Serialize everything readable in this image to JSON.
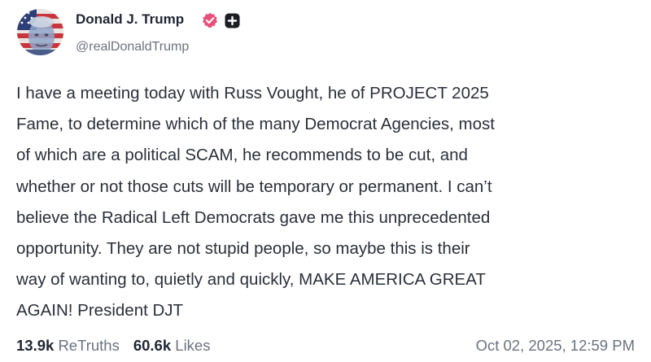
{
  "author": {
    "name": "Donald J. Trump",
    "handle": "@realDonaldTrump",
    "verified_color": "#e8507a",
    "badges": [
      "verified-icon",
      "plus-badge-icon"
    ]
  },
  "post": {
    "lines": [
      "I have a meeting today with Russ Vought, he of PROJECT 2025",
      "Fame,  to determine which of the many Democrat Agencies, most",
      "of which are a political SCAM, he recommends to be cut, and",
      "whether or not those cuts will be temporary or permanent. I can’t",
      "believe the Radical Left Democrats gave me this unprecedented",
      "opportunity. They are not stupid people, so maybe this is their",
      "way of wanting to, quietly and quickly, MAKE AMERICA GREAT",
      "AGAIN! President DJT"
    ]
  },
  "stats": {
    "retruths_count": "13.9k",
    "retruths_label": "ReTruths",
    "likes_count": "60.6k",
    "likes_label": "Likes"
  },
  "timestamp": "Oct 02, 2025, 12:59 PM"
}
